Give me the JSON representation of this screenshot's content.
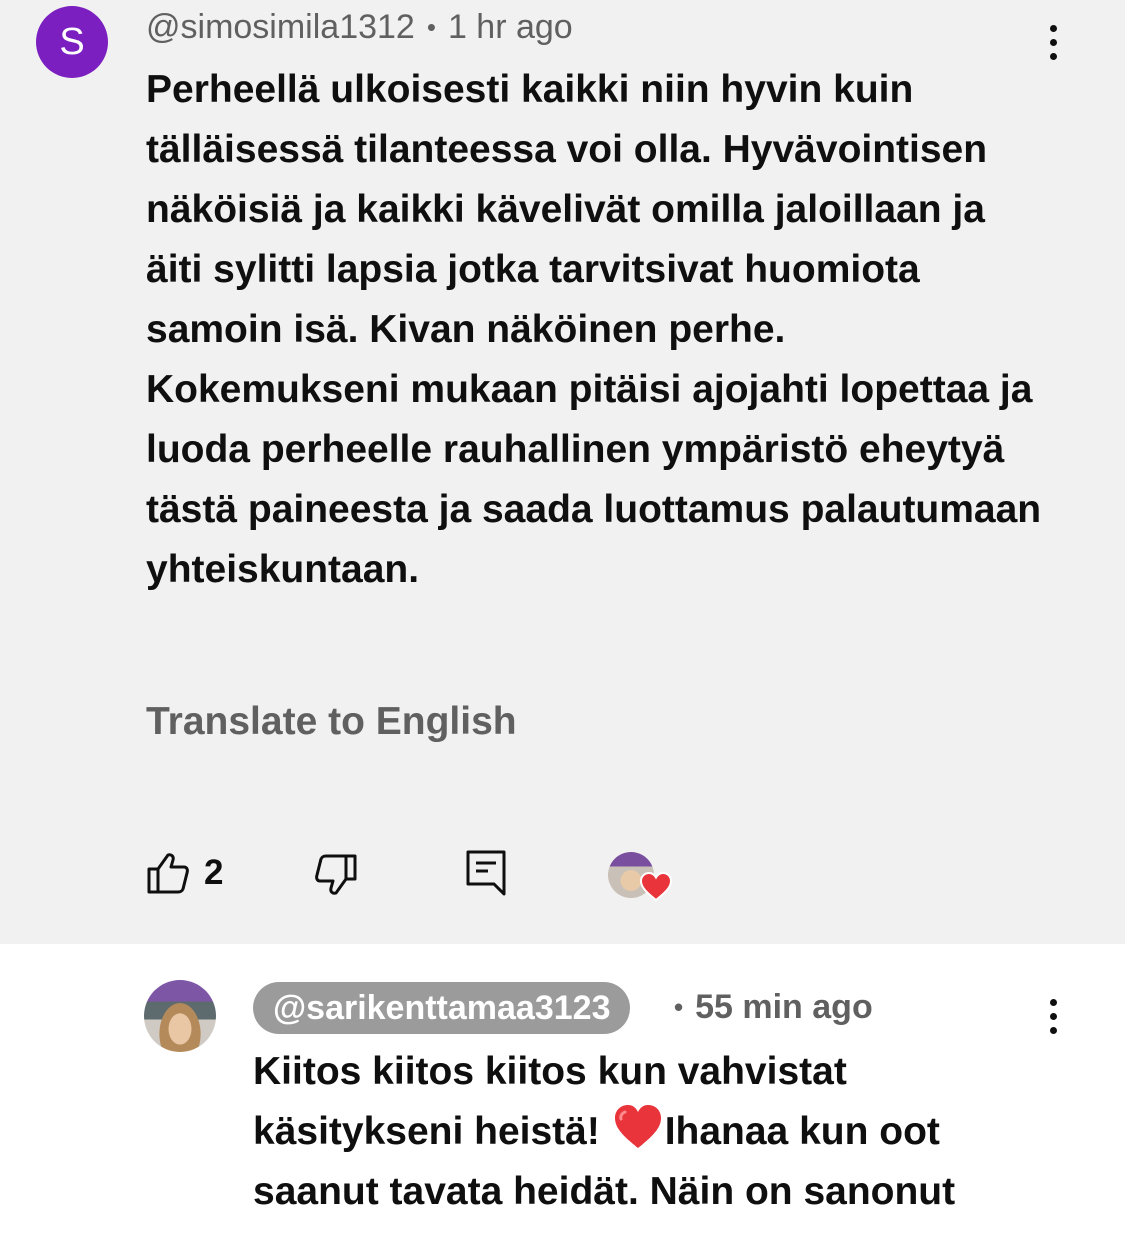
{
  "comment": {
    "avatar_letter": "S",
    "avatar_color": "#7b1fc0",
    "handle": "@simosimila1312",
    "separator": "•",
    "time": "1 hr ago",
    "text": "Perheellä ulkoisesti kaikki niin hyvin kuin tälläisessä tilanteessa voi olla. Hyvävointisen näköisiä ja kaikki kävelivät omilla jaloillaan ja äiti sylitti lapsia jotka tarvitsivat huomiota samoin isä. Kivan näköinen perhe. Kokemukseni mukaan pitäisi ajojahti lopettaa ja luoda perheelle rauhallinen ympäristö eheytyä tästä paineesta ja saada luottamus palautumaan yhteiskuntaan.",
    "translate_label": "Translate to English",
    "like_count": "2",
    "icons": {
      "like": "thumbs-up-icon",
      "dislike": "thumbs-down-icon",
      "reply": "comment-reply-icon",
      "more": "more-vertical-icon",
      "creator_heart": "creator-heart-icon"
    }
  },
  "reply": {
    "handle": "@sarikenttamaa3123",
    "separator": "•",
    "time": "55 min ago",
    "text_part1": "Kiitos kiitos kiitos kun vahvistat käsitykseni heistä! ",
    "emoji": "heart-emoji",
    "text_part2": "Ihanaa kun oot saanut tavata heidät. Näin on sanonut"
  },
  "colors": {
    "comment_bg": "#f1f1f1",
    "secondary_text": "#606060",
    "handle_chip_bg": "#9b9b9b",
    "heart_red": "#e8343a"
  }
}
